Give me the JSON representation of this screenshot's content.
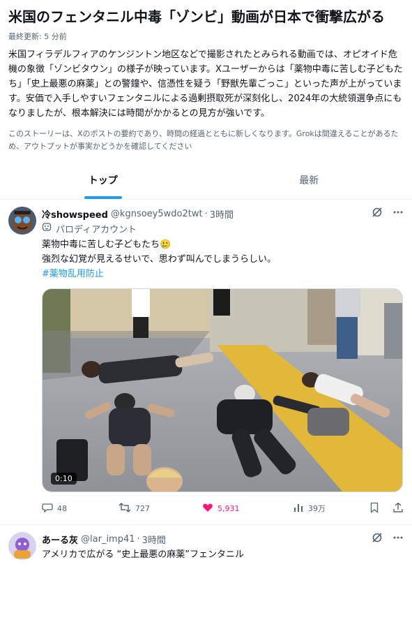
{
  "story": {
    "headline": "米国のフェンタニル中毒「ゾンビ」動画が日本で衝撃広がる",
    "updated": "最終更新: 5 分前",
    "summary": "米国フィラデルフィアのケンジントン地区などで撮影されたとみられる動画では、オピオイド危機の象徴「ゾンビタウン」の様子が映っています。Xユーザーからは「薬物中毒に苦しむ子どもたち」「史上最悪の麻薬」との警鐘や、信憑性を疑う「野獣先輩ごっこ」といった声が上がっています。安価で入手しやすいフェンタニルによる過剰摂取死が深刻化し、2024年の大統領選争点にもなりましたが、根本解決には時間がかかるとの見方が強いです。",
    "disclaimer": "このストーリーは、Xのポストの要約であり、時間の経過とともに新しくなります。Grokは間違えることがあるため、アウトプットが事実かどうかを確認してください"
  },
  "tabs": [
    {
      "label": "トップ",
      "active": true
    },
    {
      "label": "最新",
      "active": false
    }
  ],
  "posts": [
    {
      "name": "冷showspeed",
      "handle": "@kgnsoey5wdo2twt",
      "time": "3時間",
      "parody_label": "パロディアカウント",
      "text_line1": "薬物中毒に苦しむ子どもたち🥲",
      "text_line2": "強烈な幻覚が見えるせいで、思わず叫んでしまうらしい。",
      "hashtag": "#薬物乱用防止",
      "video_duration": "0:10",
      "replies": "48",
      "reposts": "727",
      "likes": "5,931",
      "views": "39万"
    },
    {
      "name": "あーる灰",
      "handle": "@lar_imp41",
      "time": "3時間",
      "text_line1": "アメリカで広がる “史上最悪の麻薬”フェンタニル"
    }
  ],
  "colors": {
    "accent": "#1d9bf0",
    "like": "#f91880",
    "secondary_text": "#536471"
  }
}
